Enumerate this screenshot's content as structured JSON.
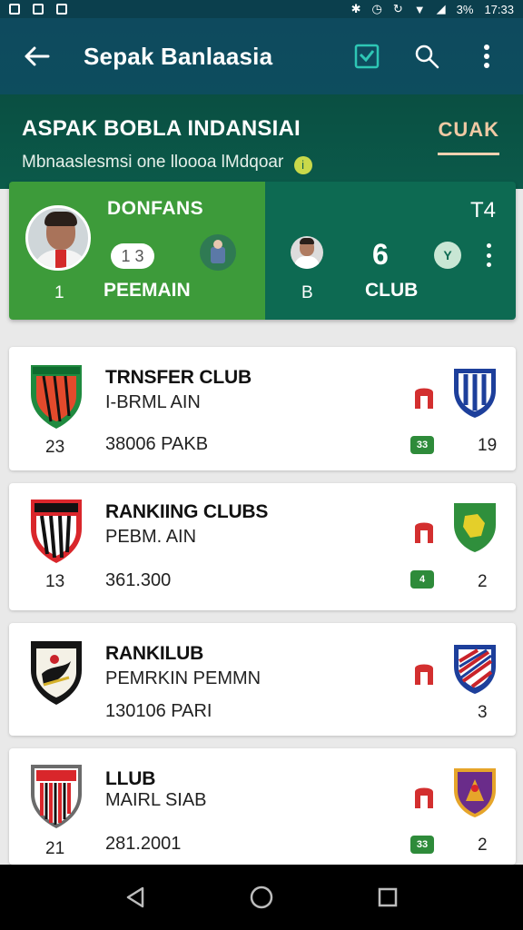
{
  "status": {
    "time": "17:33",
    "battery": "3%"
  },
  "app": {
    "title": "Sepak Banlaasia"
  },
  "league": {
    "title": "ASPAK BOBLA INDANSIAI",
    "subtitle": "Mbnaaslesmsi one lloooa lMdqoar",
    "subtitle_badge": "i",
    "tab": "CUAK"
  },
  "summary": {
    "left": {
      "title": "DONFANS",
      "pill": "1 3",
      "rank": "1",
      "label": "PEEMAIN"
    },
    "right": {
      "score": "T4",
      "count": "6",
      "badge": "Y",
      "left_code": "B",
      "label": "CLUB"
    }
  },
  "cards": [
    {
      "title": "TRNSFER CLUB",
      "subtitle": "I-BRML AIN",
      "value": "38006 PAKB",
      "rank": "23",
      "num": "19",
      "tag": "33"
    },
    {
      "title": "RANKIING CLUBS",
      "subtitle": "PEBM. AIN",
      "value": "361.300",
      "rank": "13",
      "num": "2",
      "tag": "4"
    },
    {
      "title": "RANKILUB",
      "subtitle": "PEMRKIN PEMMN",
      "value": "130106 PARI",
      "rank": "",
      "num": "3",
      "tag": ""
    },
    {
      "title": "LLUB",
      "subtitle": "MAIRL SIAB",
      "value": "281.2001",
      "rank": "21",
      "num": "2",
      "tag": "33"
    }
  ],
  "colors": {
    "app_bar": "#0e4a5e",
    "league_band": "#0b5a4a",
    "summary_left": "#3d9b3a",
    "summary_right": "#0d6a52",
    "accent_red": "#d32f2f",
    "tag_green": "#2e8b3a"
  }
}
